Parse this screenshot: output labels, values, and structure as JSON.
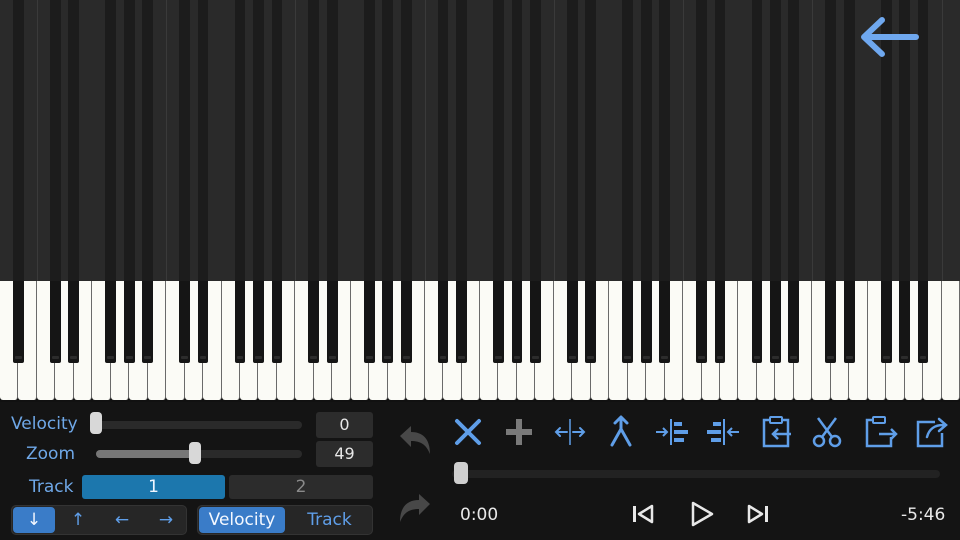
{
  "colors": {
    "accent": "#5f9ee8",
    "track_active": "#1c77ad",
    "background": "#121212"
  },
  "navigation": {
    "back_icon": "arrow-left-icon"
  },
  "piano": {
    "white_key_count": 52,
    "black_key_count": 36
  },
  "velocity": {
    "label": "Velocity",
    "value": "0",
    "level": 0
  },
  "zoom": {
    "label": "Zoom",
    "value": "49",
    "level": 0.49
  },
  "track": {
    "label": "Track",
    "options": [
      "1",
      "2"
    ],
    "selected": "1"
  },
  "direction_buttons": [
    {
      "label": "↓",
      "icon": "arrow-down-icon",
      "active": true
    },
    {
      "label": "↑",
      "icon": "arrow-up-icon",
      "active": false
    },
    {
      "label": "←",
      "icon": "arrow-left-icon",
      "active": false
    },
    {
      "label": "→",
      "icon": "arrow-right-icon",
      "active": false
    }
  ],
  "mode_toggle": {
    "options": [
      "Velocity",
      "Track"
    ],
    "selected": "Velocity"
  },
  "history": {
    "undo_icon": "undo-icon",
    "redo_icon": "redo-icon"
  },
  "toolbar": [
    "delete-icon",
    "add-icon",
    "stretch-icon",
    "merge-icon",
    "align-left-icon",
    "align-right-icon",
    "paste-icon",
    "cut-icon",
    "copy-icon",
    "share-icon"
  ],
  "playback": {
    "current_time": "0:00",
    "remaining_time": "-5:46",
    "progress": 0,
    "icons": [
      "skip-previous-icon",
      "play-icon",
      "skip-next-icon"
    ]
  }
}
